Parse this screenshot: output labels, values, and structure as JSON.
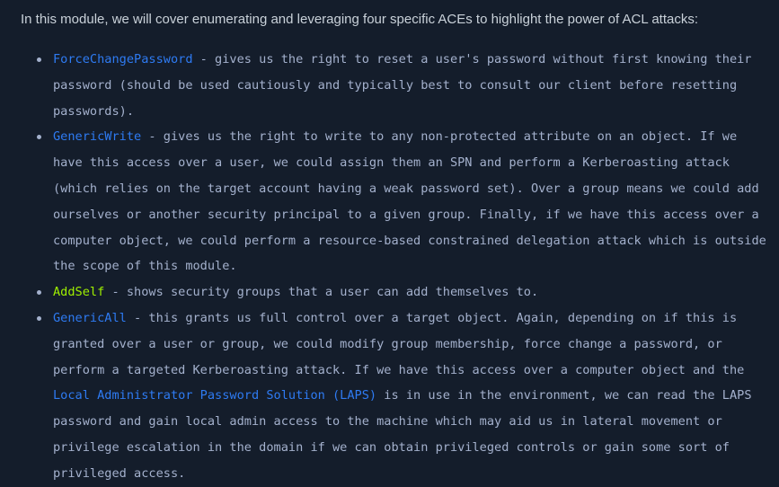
{
  "intro": "In this module, we will cover enumerating and leveraging four specific ACEs to highlight the power of ACL attacks:",
  "items": [
    {
      "term": "ForceChangePassword",
      "lines": [
        " - gives us the right to reset a user's password without first knowing their",
        "password (should be used cautiously and typically best to consult our client before resetting",
        "passwords)."
      ]
    },
    {
      "term": "GenericWrite",
      "lines": [
        " - gives us the right to write to any non-protected attribute on an object. If we",
        "have this access over a user, we could assign them an SPN and perform a Kerberoasting attack",
        "(which relies on the target account having a weak password set). Over a group means we could add",
        "ourselves or another security principal to a given group. Finally, if we have this access over a",
        "computer object, we could perform a resource-based constrained delegation attack which is outside",
        "the scope of this module."
      ]
    },
    {
      "term": "AddSelf",
      "lines": [
        " - shows security groups that a user can add themselves to."
      ]
    },
    {
      "term": "GenericAll",
      "lines": [
        " - this grants us full control over a target object. Again, depending on if this is",
        "granted over a user or group, we could modify group membership, force change a password, or",
        "perform a targeted Kerberoasting attack. If we have this access over a computer object and the"
      ],
      "link": "Local Administrator Password Solution (LAPS)",
      "after_link": " is in use in the environment, we can read the LAPS",
      "tail_lines": [
        "password and gain local admin access to the machine which may aid us in lateral movement or",
        "privilege escalation in the domain if we can obtain privileged controls or gain some sort of",
        "privileged access."
      ]
    }
  ],
  "colors": {
    "background": "#141d2b",
    "text": "#a4b1cd",
    "link": "#2e7bf3",
    "highlight": "#9fef00"
  }
}
